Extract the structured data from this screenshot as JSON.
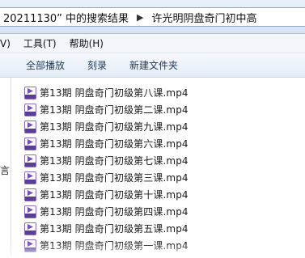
{
  "address_bar": {
    "crumbs": [
      "20211130” 中的搜索结果",
      "许光明阴盘奇门初中高"
    ]
  },
  "menu": {
    "items": [
      "V)",
      "工具(T)",
      "帮助(H)"
    ]
  },
  "toolbar": {
    "play_all": "全部播放",
    "burn": "刻录",
    "new_folder": "新建文件夹"
  },
  "nav_pane": {
    "visible_char": "言"
  },
  "files": [
    "第13期 阴盘奇门初级第八课.mp4",
    "第13期 阴盘奇门初级第二课.mp4",
    "第13期 阴盘奇门初级第九课.mp4",
    "第13期 阴盘奇门初级第六课.mp4",
    "第13期 阴盘奇门初级第七课.mp4",
    "第13期 阴盘奇门初级第三课.mp4",
    "第13期 阴盘奇门初级第十课.mp4",
    "第13期 阴盘奇门初级第四课.mp4",
    "第13期 阴盘奇门初级第五课.mp4",
    "第13期 阴盘奇门初级第一课.mp4"
  ],
  "colors": {
    "toolbar_text": "#1e395b",
    "icon_purple": "#7b4fb3"
  }
}
